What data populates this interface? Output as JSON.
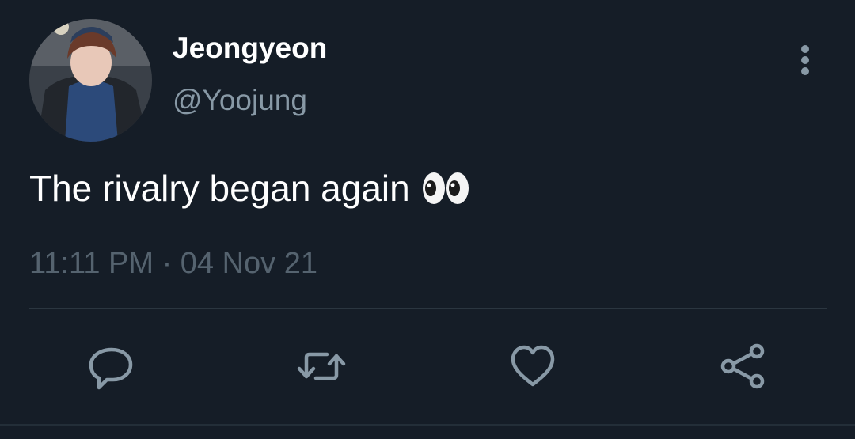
{
  "tweet": {
    "display_name": "Jeongyeon",
    "handle": "@Yoojung",
    "text": "The rivalry began again",
    "emoji": "eyes-emoji",
    "timestamp": "11:11 PM · 04 Nov 21"
  },
  "icons": {
    "more": "more-vertical-icon",
    "reply": "reply-icon",
    "retweet": "retweet-icon",
    "like": "heart-icon",
    "share": "share-icon"
  },
  "colors": {
    "background": "#151d27",
    "primary_text": "#ffffff",
    "secondary_text": "#8899a6",
    "timestamp_text": "#55636f",
    "icon": "#8899a6",
    "divider": "#2b3640"
  }
}
